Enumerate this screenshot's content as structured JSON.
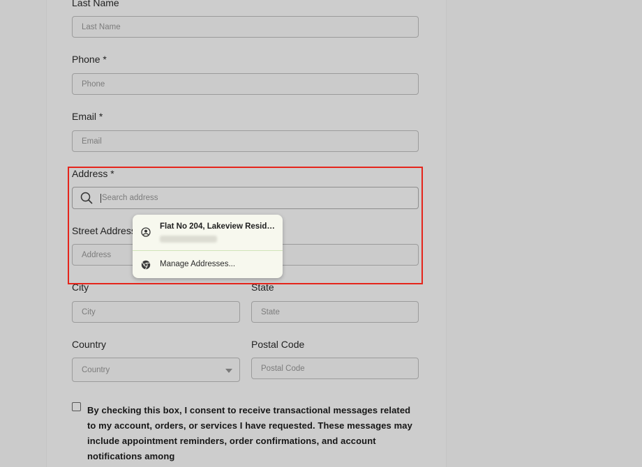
{
  "form": {
    "last_name": {
      "label": "Last Name",
      "placeholder": "Last Name"
    },
    "phone": {
      "label": "Phone *",
      "placeholder": "Phone"
    },
    "email": {
      "label": "Email *",
      "placeholder": "Email"
    },
    "address": {
      "label": "Address *",
      "placeholder": "Search address"
    },
    "street_address": {
      "label": "Street Address",
      "placeholder": "Address"
    },
    "city": {
      "label": "City",
      "placeholder": "City"
    },
    "state": {
      "label": "State",
      "placeholder": "State"
    },
    "country": {
      "label": "Country",
      "placeholder": "Country"
    },
    "postal_code": {
      "label": "Postal Code",
      "placeholder": "Postal Code"
    },
    "consent_text": "By checking this box, I consent to receive transactional messages related to my account, orders, or services I have requested. These messages may include appointment reminders, order confirmations, and account notifications among"
  },
  "autofill": {
    "suggestion_title": "Flat No 204, Lakeview Resid…",
    "manage_label": "Manage Addresses..."
  },
  "colors": {
    "highlight": "#e5241b",
    "dropdown_bg": "#f7f8ee"
  },
  "icons": {
    "search": "search-icon",
    "account": "account-circle-icon",
    "chrome": "chrome-icon",
    "dropdown": "chevron-down-icon"
  }
}
